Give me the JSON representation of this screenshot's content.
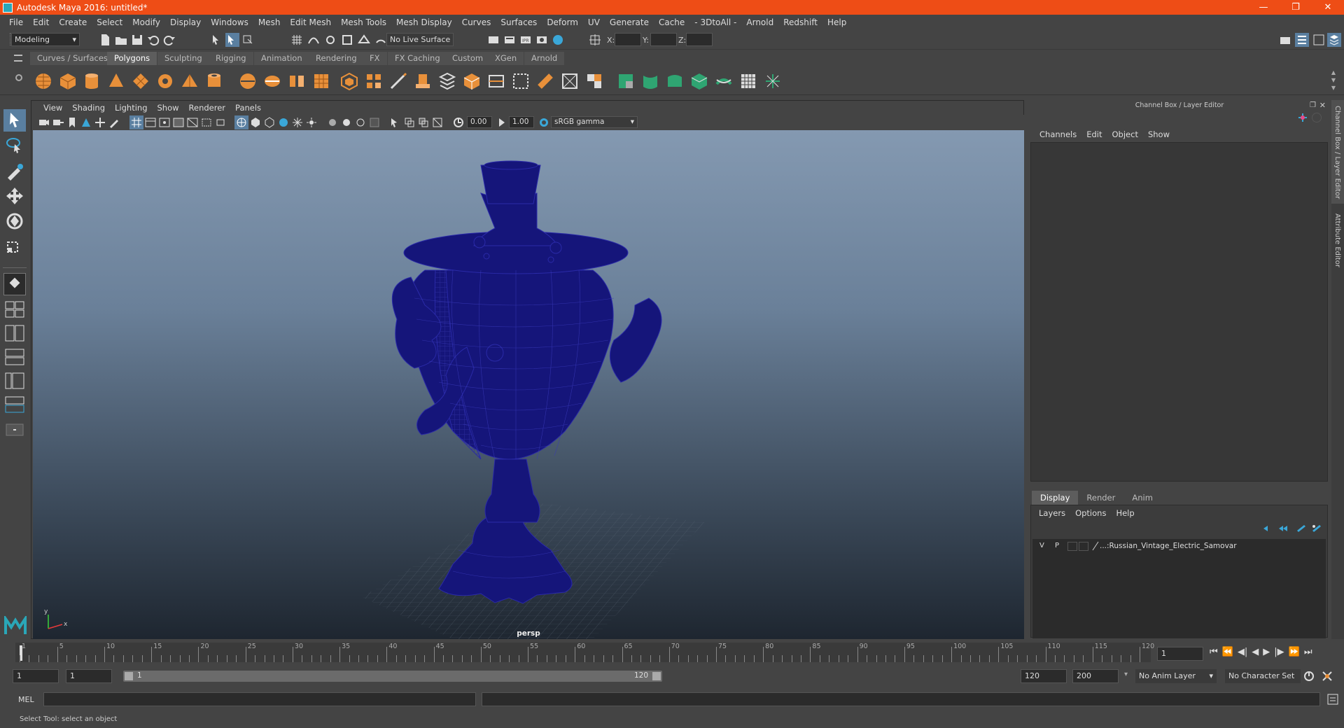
{
  "window": {
    "title": "Autodesk Maya 2016: untitled*",
    "controls": [
      "minimize-icon",
      "restore-icon",
      "close-icon"
    ]
  },
  "menu": [
    "File",
    "Edit",
    "Create",
    "Select",
    "Modify",
    "Display",
    "Windows",
    "Mesh",
    "Edit Mesh",
    "Mesh Tools",
    "Mesh Display",
    "Curves",
    "Surfaces",
    "Deform",
    "UV",
    "Generate",
    "Cache",
    "- 3DtoAll -",
    "Arnold",
    "Redshift",
    "Help"
  ],
  "status": {
    "menu_set": "Modeling",
    "live_surface": "No Live Surface",
    "x_label": "X:",
    "y_label": "Y:",
    "z_label": "Z:"
  },
  "shelf_tabs": [
    "Curves / Surfaces",
    "Polygons",
    "Sculpting",
    "Rigging",
    "Animation",
    "Rendering",
    "FX",
    "FX Caching",
    "Custom",
    "XGen",
    "Arnold"
  ],
  "shelf_active": "Polygons",
  "viewport": {
    "menu": [
      "View",
      "Shading",
      "Lighting",
      "Show",
      "Renderer",
      "Panels"
    ],
    "exposure": "0.00",
    "gamma": "1.00",
    "color_space": "sRGB gamma",
    "camera_label": "persp"
  },
  "channel_box": {
    "title": "Channel Box / Layer Editor",
    "menu": [
      "Channels",
      "Edit",
      "Object",
      "Show"
    ],
    "side_tabs": [
      "Channel Box / Layer Editor",
      "Attribute Editor"
    ],
    "layer_tabs": [
      "Display",
      "Render",
      "Anim"
    ],
    "layer_menu": [
      "Layers",
      "Options",
      "Help"
    ],
    "layer": {
      "v": "V",
      "p": "P",
      "name": "...:Russian_Vintage_Electric_Samovar"
    }
  },
  "timeline": {
    "ticks": [
      "1",
      "5",
      "10",
      "15",
      "20",
      "25",
      "30",
      "35",
      "40",
      "45",
      "50",
      "55",
      "60",
      "65",
      "70",
      "75",
      "80",
      "85",
      "90",
      "95",
      "100",
      "105",
      "110",
      "115",
      "120"
    ],
    "current_frame": "1"
  },
  "range": {
    "start": "1",
    "playback_start": "1",
    "slider_start": "1",
    "slider_end": "120",
    "playback_end": "120",
    "end": "200",
    "anim_layer": "No Anim Layer",
    "char_set": "No Character Set"
  },
  "command": {
    "label": "MEL"
  },
  "help_line": "Select Tool: select an object",
  "colors": {
    "titlebar": "#ee4d16",
    "shelf_icon": "#e8903a",
    "wireframe": "#15157a",
    "accent_green": "#2fa572"
  }
}
